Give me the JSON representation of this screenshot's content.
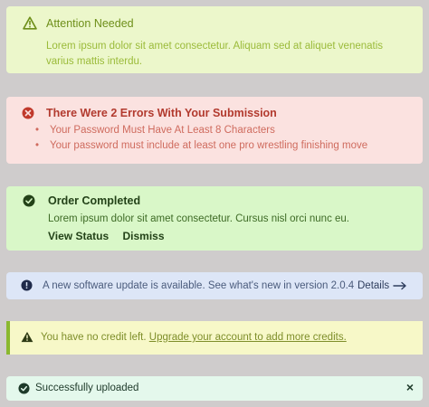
{
  "alerts": {
    "attention": {
      "icon": "warning-triangle-icon",
      "title": "Attention Needed",
      "line1": "Lorem ipsum dolor sit amet consectetur. Aliquam sed at aliquet venenatis",
      "line2": "varius mattis interdu."
    },
    "errors": {
      "icon": "error-x-circle-icon",
      "title": "There Were 2 Errors With Your Submission",
      "items": [
        "Your Password Must Have At Least 8 Characters",
        "Your password must include at least one pro wrestling finishing move"
      ]
    },
    "order": {
      "icon": "check-circle-icon",
      "title": "Order Completed",
      "body": "Lorem ipsum dolor sit amet consectetur. Cursus nisl orci nunc eu.",
      "view_status": "View Status",
      "dismiss": "Dismiss"
    },
    "update": {
      "icon": "info-circle-icon",
      "text": "A new software update is available. See what's new in version 2.0.4",
      "details": "Details"
    },
    "credit": {
      "icon": "warning-triangle-icon",
      "text": "You have no credit left.",
      "link": "Upgrade your account to add more credits."
    },
    "uploaded": {
      "icon": "check-circle-icon",
      "text": "Successfully uploaded",
      "close": "×"
    }
  },
  "colors": {
    "background": "#cfcccc",
    "attention_bg": "#ecf7cb",
    "error_bg": "#fbe2e0",
    "success_bg": "#d9f7c8",
    "info_bg": "#dde6f7",
    "credit_bg": "#f7f8c8",
    "uploaded_bg": "#e4f8ec"
  }
}
